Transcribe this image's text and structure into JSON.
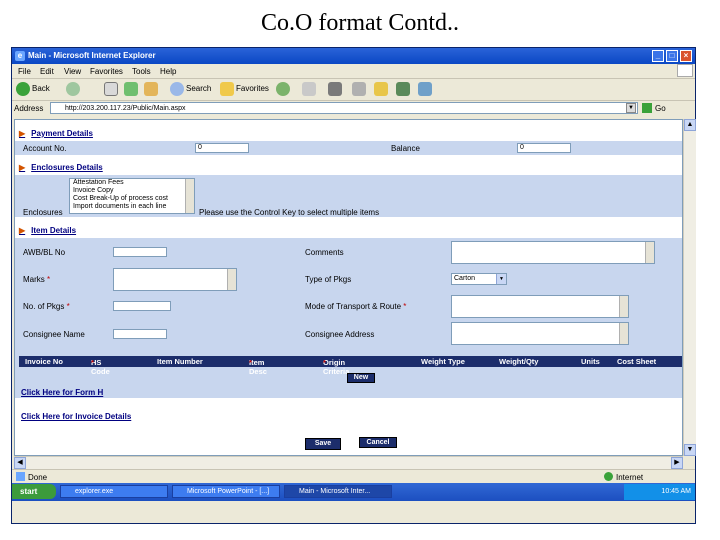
{
  "slide": {
    "title": "Co.O format Contd.."
  },
  "window": {
    "title": "Main - Microsoft Internet Explorer"
  },
  "menu": [
    "File",
    "Edit",
    "View",
    "Favorites",
    "Tools",
    "Help"
  ],
  "toolbar": {
    "back": "Back",
    "search": "Search",
    "favorites": "Favorites"
  },
  "address": {
    "label": "Address",
    "url": "http://203.200.117.23/Public/Main.aspx",
    "go": "Go"
  },
  "payment": {
    "heading": "Payment Details",
    "account_label": "Account No.",
    "account_value": "0",
    "balance_label": "Balance",
    "balance_value": "0"
  },
  "enclosures": {
    "heading": "Enclosures Details",
    "label": "Enclosures",
    "options": [
      "Attestation Fees",
      "Invoice Copy",
      "Cost Break-Up of process cost",
      "Import documents in each line"
    ],
    "hint": "Please use the Control Key to select multiple items"
  },
  "item": {
    "heading": "Item Details",
    "awb_label": "AWB/BL No",
    "comments_label": "Comments",
    "marks_label": "Marks",
    "type_label": "Type of Pkgs",
    "type_value": "Carton",
    "pkgs_label": "No. of Pkgs",
    "mode_label": "Mode of Transport & Route",
    "consignee_name_label": "Consignee Name",
    "consignee_address_label": "Consignee Address"
  },
  "required_mark": "*",
  "table": {
    "columns": [
      "Invoice No",
      "HS Code",
      "Item Number",
      "Item Desc",
      "Origin Criteria",
      "Weight Type",
      "Weight/Qty",
      "Units",
      "Cost Sheet"
    ],
    "required": [
      false,
      true,
      false,
      true,
      true,
      false,
      false,
      false,
      false
    ],
    "new_label": "New"
  },
  "links": {
    "form_h": "Click Here for Form H",
    "invoice": "Click Here for Invoice Details"
  },
  "actions": {
    "save": "Save",
    "cancel": "Cancel"
  },
  "status": {
    "left": "Done",
    "right": "Internet"
  },
  "taskbar": {
    "start": "start",
    "tasks": [
      "explorer.exe",
      "Microsoft PowerPoint - [...]",
      "Main - Microsoft Inter..."
    ],
    "clock": "10:45 AM"
  },
  "colors": {
    "title_bar": "#0a47c4",
    "band": "#c8d6ee",
    "header": "#1c2d6b",
    "required": "#c00000"
  }
}
